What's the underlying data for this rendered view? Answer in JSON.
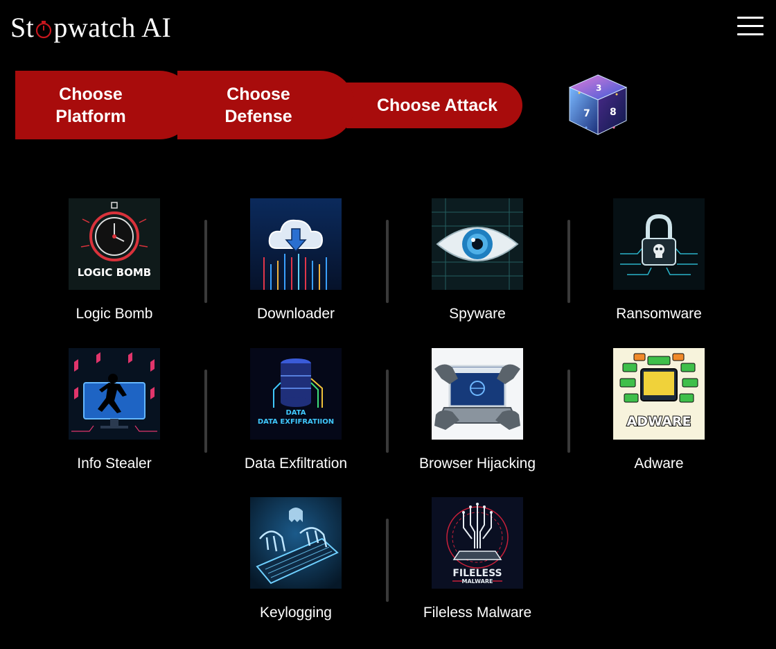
{
  "app": {
    "logo_before": "St",
    "logo_after": "pwatch AI"
  },
  "steps": {
    "platform": "Choose Platform",
    "defense": "Choose Defense",
    "attack": "Choose Attack"
  },
  "icons": {
    "menu": "hamburger-menu-icon",
    "stopwatch": "stopwatch-icon",
    "cube": "dice-cube-icon"
  },
  "colors": {
    "step_red": "#a80c0c",
    "background": "#000000"
  },
  "attacks": [
    {
      "label": "Logic Bomb",
      "thumb_text": "LOGIC BOMB"
    },
    {
      "label": "Downloader"
    },
    {
      "label": "Spyware"
    },
    {
      "label": "Ransomware"
    },
    {
      "label": "Info Stealer"
    },
    {
      "label": "Data Exfiltration",
      "thumb_text": "DATA EXFIFRATIION"
    },
    {
      "label": "Browser Hijacking"
    },
    {
      "label": "Adware",
      "thumb_text": "ADWARE"
    },
    {
      "label": "Keylogging"
    },
    {
      "label": "Fileless Malware",
      "thumb_text_1": "FILELESS",
      "thumb_text_2": "MALWARE"
    }
  ]
}
